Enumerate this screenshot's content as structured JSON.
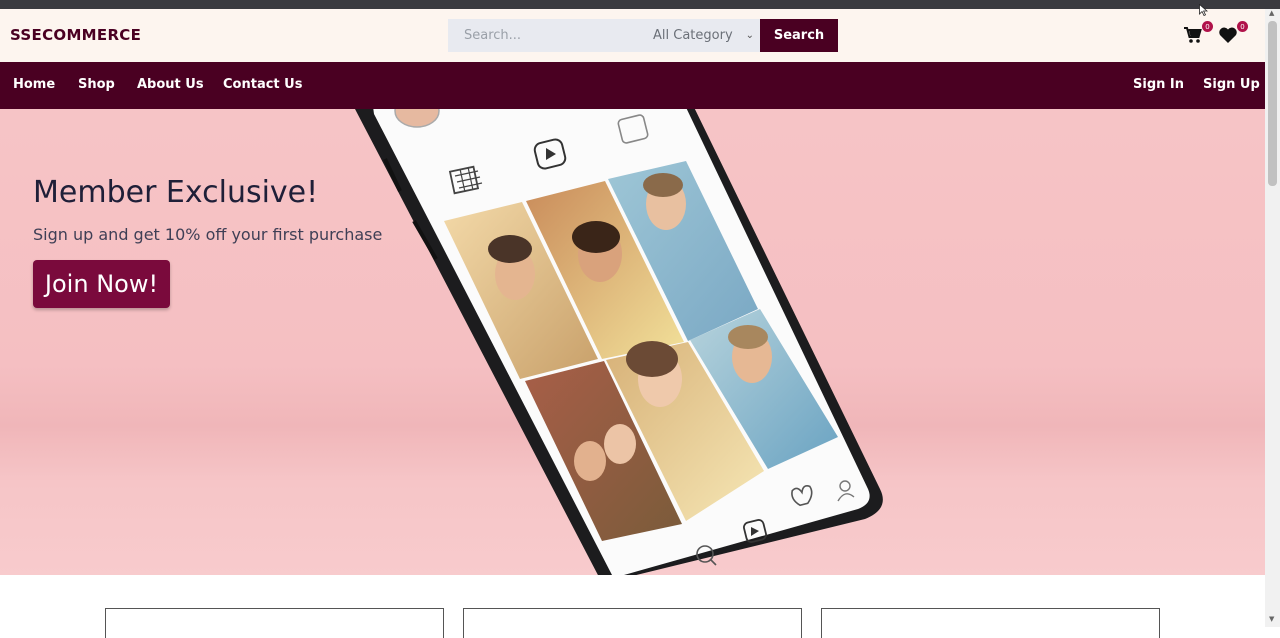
{
  "brand": "SSECOMMERCE",
  "search": {
    "placeholder": "Search...",
    "category": "All Category",
    "button": "Search"
  },
  "header_icons": {
    "cart_icon": "cart-icon",
    "cart_count": "0",
    "wishlist_icon": "heart-icon",
    "wishlist_count": "0"
  },
  "nav": {
    "left": [
      {
        "label": "Home"
      },
      {
        "label": "Shop"
      },
      {
        "label": "About Us"
      },
      {
        "label": "Contact Us"
      }
    ],
    "right": [
      {
        "label": "Sign In"
      },
      {
        "label": "Sign Up"
      }
    ]
  },
  "hero": {
    "title": "Member Exclusive!",
    "subtitle": "Sign up and get 10% off your first purchase",
    "button": "Join Now!"
  },
  "colors": {
    "brand": "#4a0022",
    "accent": "#7a0a3c",
    "hero_bg": "#f6c4c6",
    "header_bg": "#fdf5ef"
  }
}
